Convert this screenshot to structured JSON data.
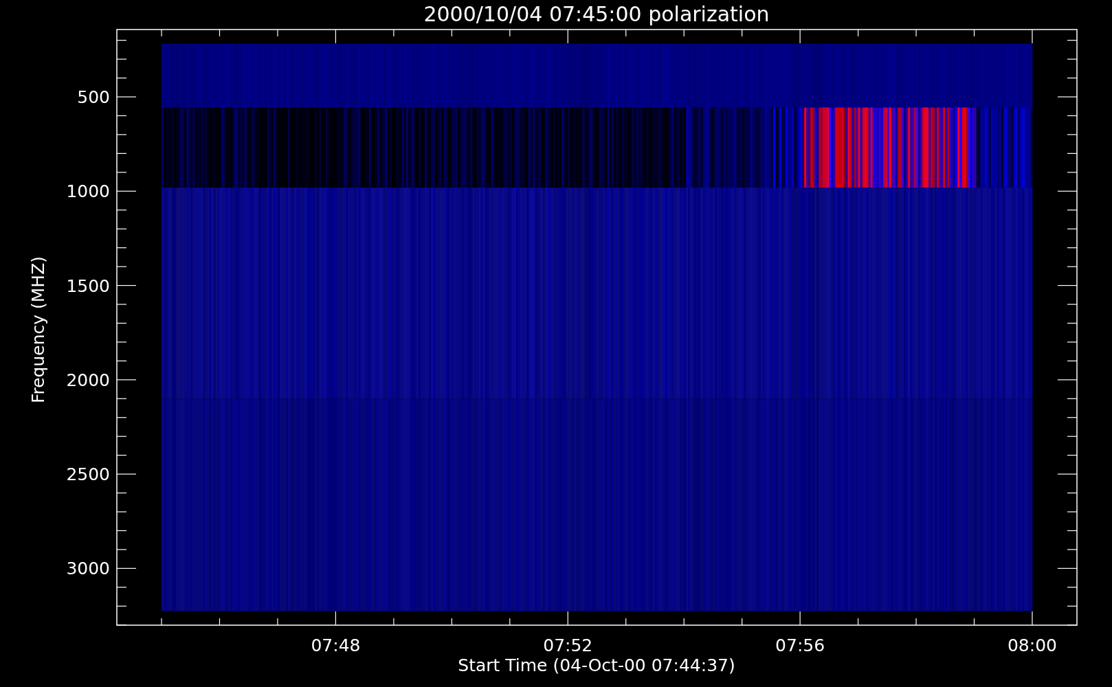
{
  "plot": {
    "title": "2000/10/04 07:45:00 polarization",
    "xlabel": "Start Time (04-Oct-00 07:44:37)",
    "ylabel": "Frequency (MHZ)",
    "xticks": [
      "07:48",
      "07:52",
      "07:56",
      "08:00"
    ],
    "yticks": [
      "500",
      "1000",
      "1500",
      "2000",
      "2500",
      "3000"
    ]
  }
}
